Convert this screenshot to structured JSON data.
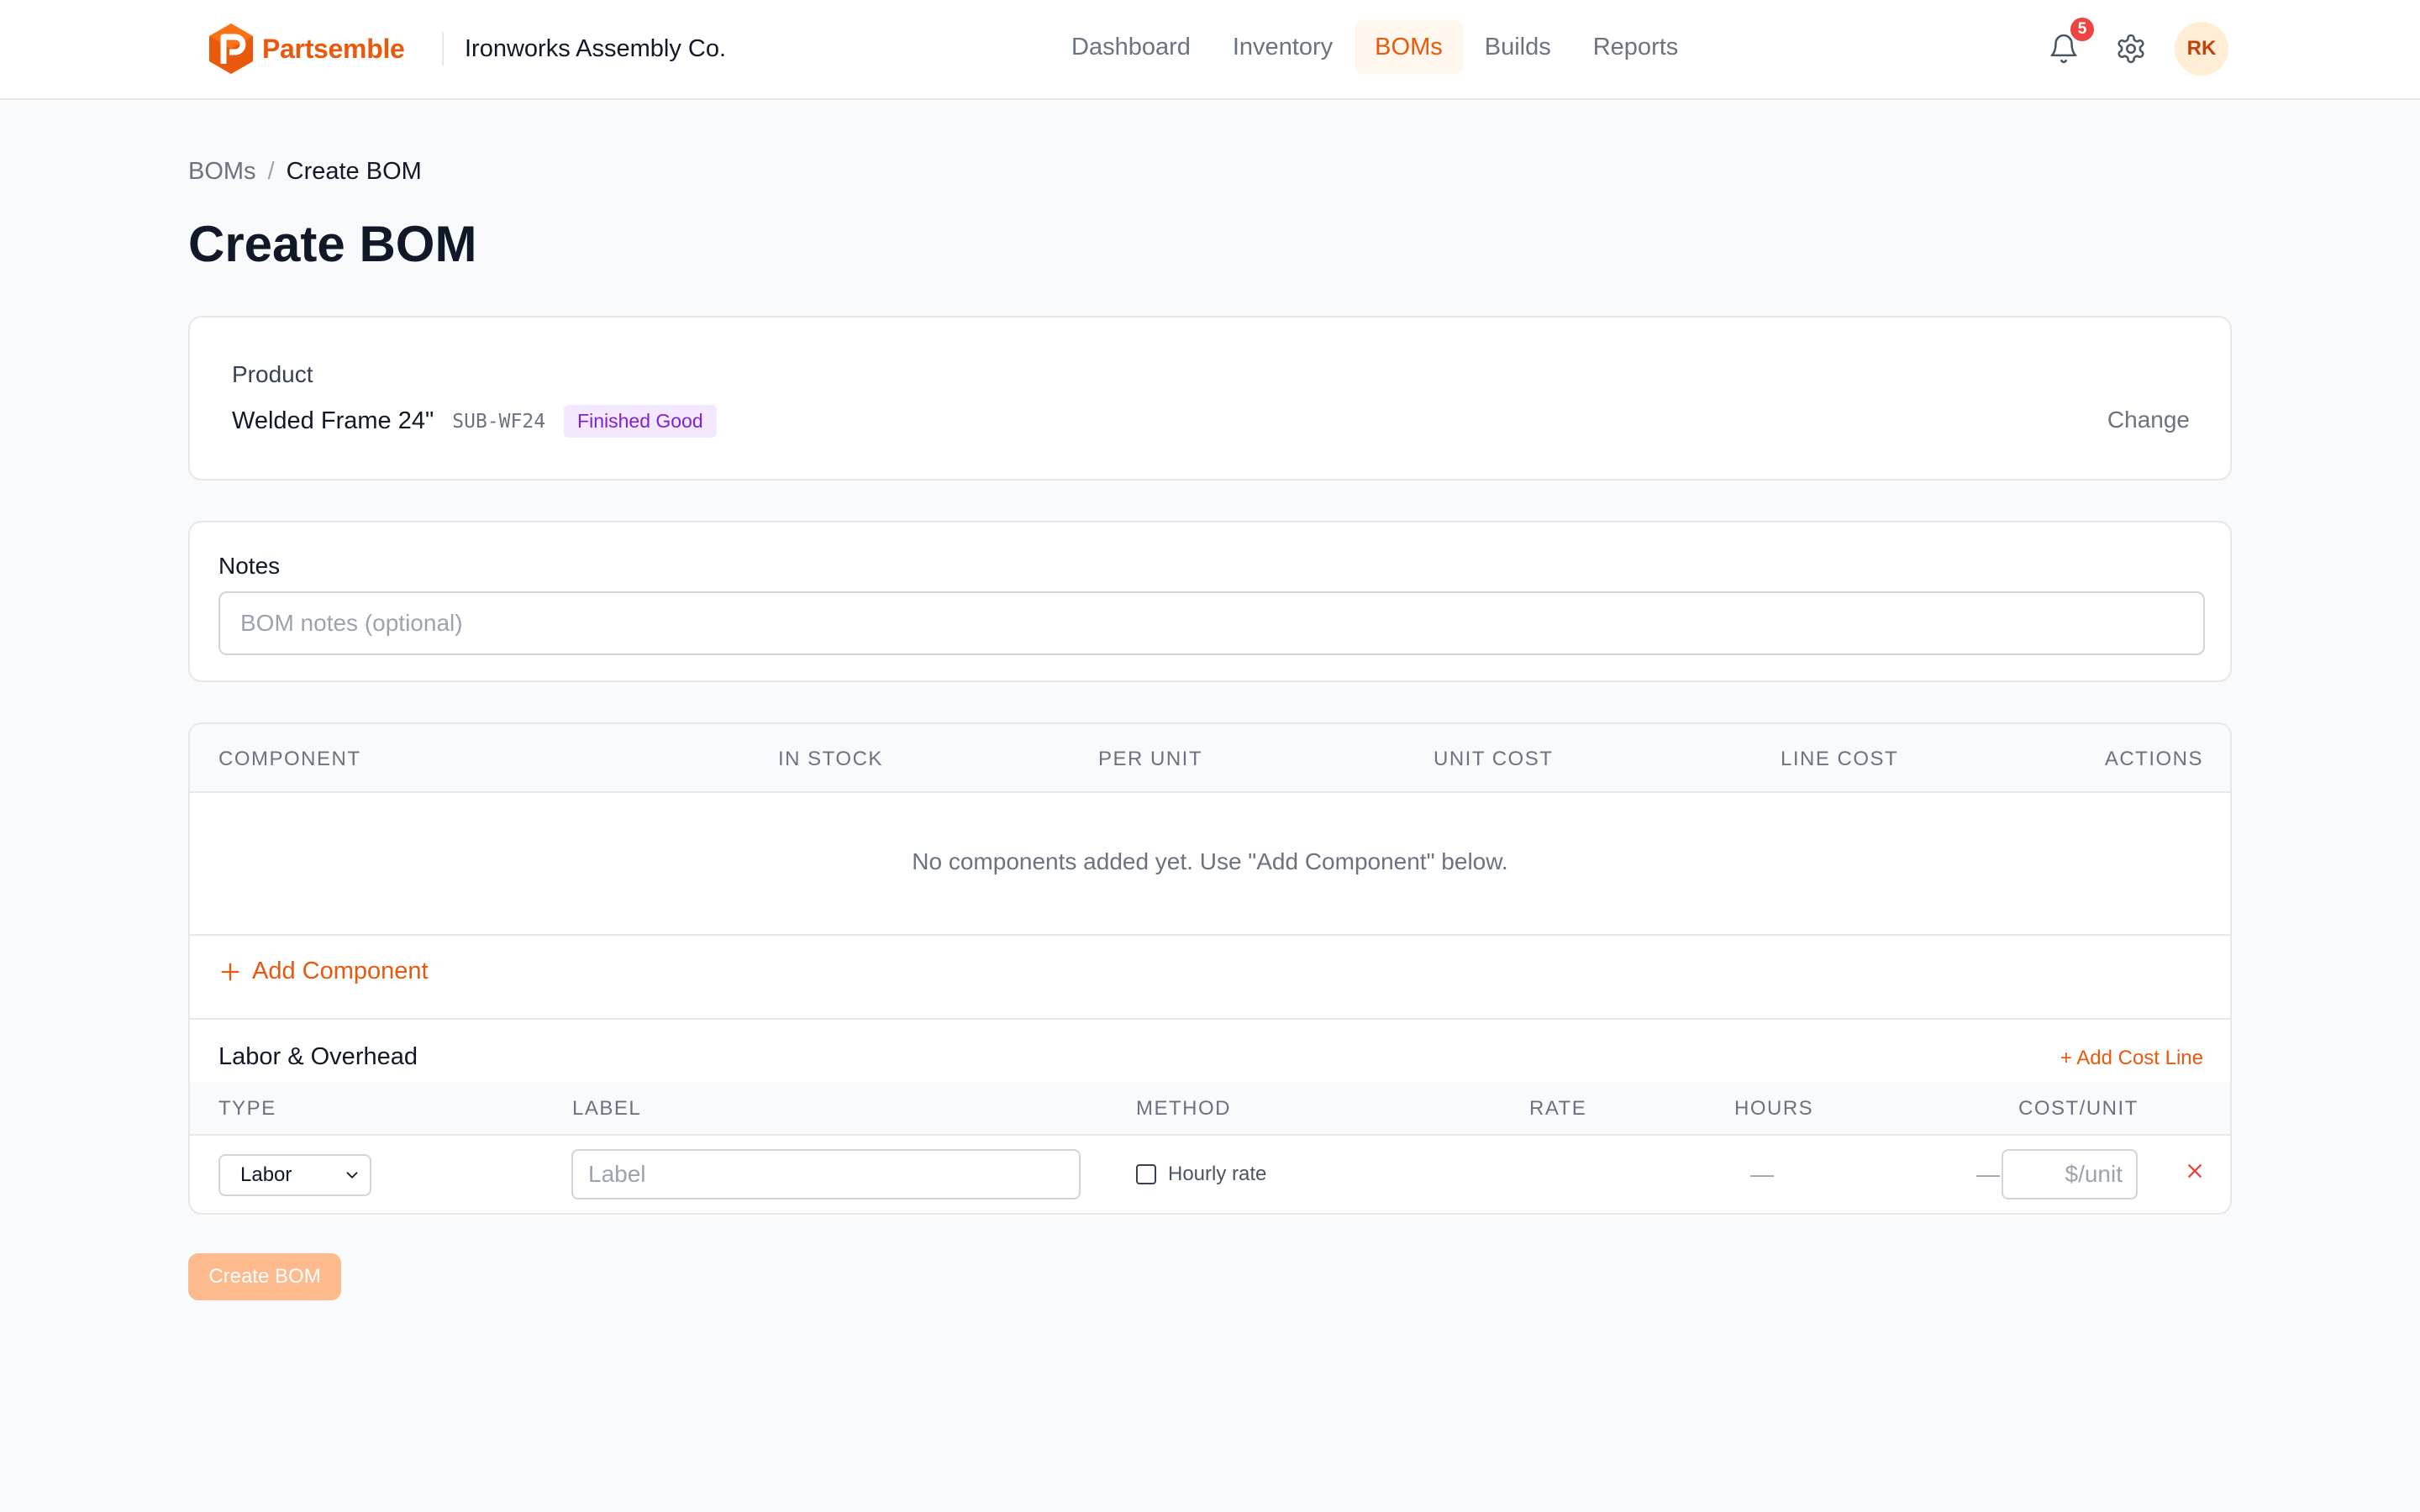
{
  "app": {
    "name": "Partsemble",
    "company": "Ironworks Assembly Co.",
    "brand_color": "#ea580c"
  },
  "nav": {
    "items": [
      {
        "label": "Dashboard",
        "active": false
      },
      {
        "label": "Inventory",
        "active": false
      },
      {
        "label": "BOMs",
        "active": true
      },
      {
        "label": "Builds",
        "active": false
      },
      {
        "label": "Reports",
        "active": false
      }
    ]
  },
  "header": {
    "notification_count": "5",
    "avatar_initials": "RK",
    "icons": [
      "bell-icon",
      "gear-icon"
    ]
  },
  "breadcrumb": {
    "items": [
      "BOMs",
      "Create BOM"
    ],
    "separator": "/"
  },
  "page": {
    "title": "Create BOM"
  },
  "product": {
    "label": "Product",
    "name": "Welded Frame 24\"",
    "sku": "SUB-WF24",
    "tag": "Finished Good",
    "change_label": "Change"
  },
  "notes": {
    "label": "Notes",
    "placeholder": "BOM notes (optional)",
    "value": ""
  },
  "components": {
    "columns": [
      "COMPONENT",
      "IN STOCK",
      "PER UNIT",
      "UNIT COST",
      "LINE COST",
      "ACTIONS"
    ],
    "empty_message": "No components added yet. Use \"Add Component\" below.",
    "add_label": "Add Component"
  },
  "labor": {
    "title": "Labor & Overhead",
    "add_label": "+ Add Cost Line",
    "columns": [
      "TYPE",
      "LABEL",
      "METHOD",
      "RATE",
      "HOURS",
      "COST/UNIT"
    ],
    "rows": [
      {
        "type": "Labor",
        "label_placeholder": "Label",
        "method_label": "Hourly rate",
        "hourly_checked": false,
        "rate": "—",
        "hours": "—",
        "cost_placeholder": "$/unit"
      }
    ]
  },
  "actions": {
    "create_label": "Create BOM"
  }
}
